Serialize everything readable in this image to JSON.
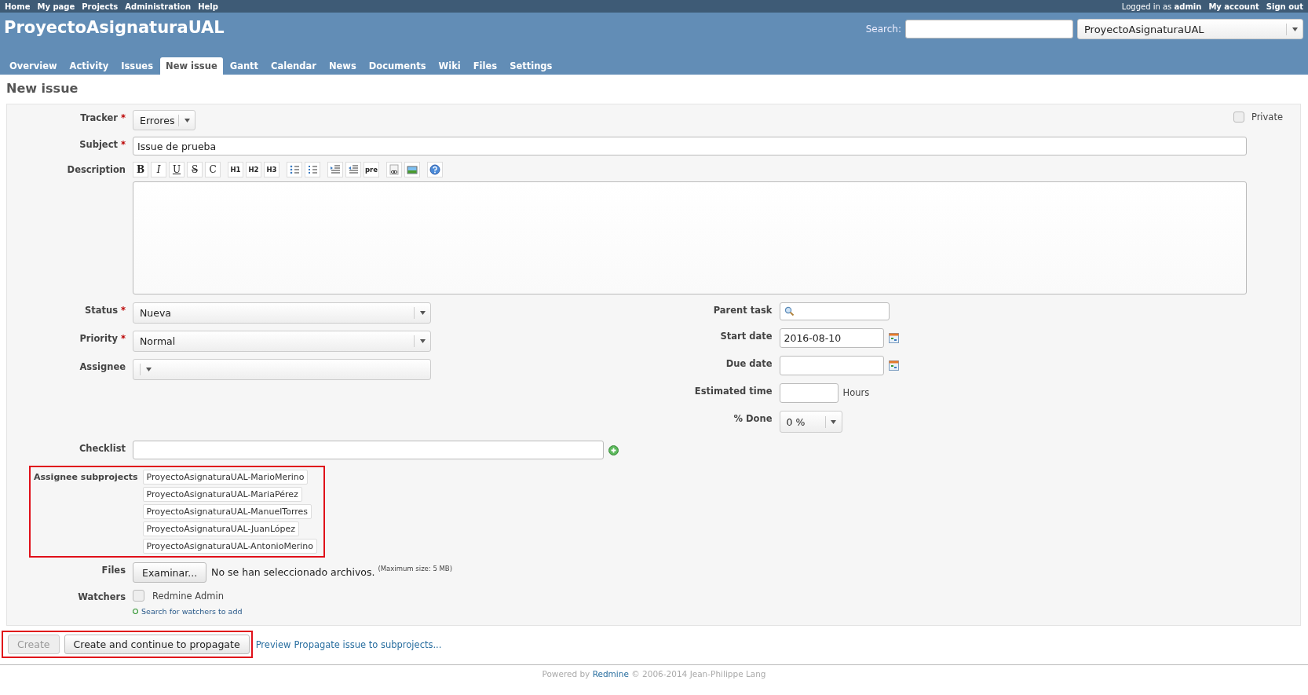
{
  "top_menu": {
    "left": [
      "Home",
      "My page",
      "Projects",
      "Administration",
      "Help"
    ],
    "logged_in_prefix": "Logged in as",
    "user": "admin",
    "right": [
      "My account",
      "Sign out"
    ]
  },
  "header": {
    "title": "ProyectoAsignaturaUAL",
    "search_label": "Search:",
    "project_select": "ProyectoAsignaturaUAL"
  },
  "tabs": [
    {
      "label": "Overview",
      "selected": false
    },
    {
      "label": "Activity",
      "selected": false
    },
    {
      "label": "Issues",
      "selected": false
    },
    {
      "label": "New issue",
      "selected": true
    },
    {
      "label": "Gantt",
      "selected": false
    },
    {
      "label": "Calendar",
      "selected": false
    },
    {
      "label": "News",
      "selected": false
    },
    {
      "label": "Documents",
      "selected": false
    },
    {
      "label": "Wiki",
      "selected": false
    },
    {
      "label": "Files",
      "selected": false
    },
    {
      "label": "Settings",
      "selected": false
    }
  ],
  "page_title": "New issue",
  "form": {
    "tracker": {
      "label": "Tracker",
      "required_mark": "*",
      "value": "Errores"
    },
    "private": {
      "label": "Private",
      "checked": false
    },
    "subject": {
      "label": "Subject",
      "required_mark": "*",
      "value": "Issue de prueba"
    },
    "description": {
      "label": "Description",
      "toolbar": [
        [
          {
            "kind": "bold",
            "text": "B"
          },
          {
            "kind": "italic",
            "text": "I"
          },
          {
            "kind": "underline",
            "text": "U"
          },
          {
            "kind": "strike",
            "text": "S"
          },
          {
            "kind": "plain",
            "text": "C"
          }
        ],
        [
          {
            "kind": "small",
            "text": "H1"
          },
          {
            "kind": "small",
            "text": "H2"
          },
          {
            "kind": "small",
            "text": "H3"
          }
        ],
        [
          {
            "kind": "bullets"
          },
          {
            "kind": "numbers"
          }
        ],
        [
          {
            "kind": "indent"
          },
          {
            "kind": "outdent"
          },
          {
            "kind": "small",
            "text": "pre"
          }
        ],
        [
          {
            "kind": "link"
          },
          {
            "kind": "image"
          }
        ],
        [
          {
            "kind": "help"
          }
        ]
      ]
    },
    "left_fields": [
      {
        "label": "Status",
        "required_mark": "*",
        "value": "Nueva"
      },
      {
        "label": "Priority",
        "required_mark": "*",
        "value": "Normal"
      },
      {
        "label": "Assignee"
      }
    ],
    "right_fields": [
      {
        "kind": "search",
        "label": "Parent task"
      },
      {
        "kind": "date",
        "label": "Start date",
        "value": "2016-08-10"
      },
      {
        "kind": "date",
        "label": "Due date"
      },
      {
        "kind": "hours",
        "label": "Estimated time",
        "unit": "Hours"
      },
      {
        "kind": "select",
        "label": "% Done",
        "value": "0 %"
      }
    ],
    "checklist": {
      "label": "Checklist"
    },
    "assignee_subprojects": {
      "label": "Assignee subprojects",
      "highlighted": true,
      "items": [
        "ProyectoAsignaturaUAL-MarioMerino",
        "ProyectoAsignaturaUAL-MariaPérez",
        "ProyectoAsignaturaUAL-ManuelTorres",
        "ProyectoAsignaturaUAL-JuanLópez",
        "ProyectoAsignaturaUAL-AntonioMerino"
      ]
    },
    "files": {
      "label": "Files",
      "button": "Examinar...",
      "status": "No se han seleccionado archivos.",
      "max_size": "(Maximum size: 5 MB)"
    },
    "watchers": {
      "label": "Watchers",
      "items": [
        {
          "label": "Redmine Admin",
          "checked": false
        }
      ],
      "search_link": "Search for watchers to add"
    }
  },
  "actions": {
    "highlighted": true,
    "create": {
      "label": "Create",
      "disabled": true
    },
    "create_continue": "Create and continue to propagate",
    "preview_link": "Preview",
    "propagate_link": "Propagate issue to subprojects..."
  },
  "footer": {
    "prefix": "Powered by",
    "link": "Redmine",
    "suffix": "© 2006-2014 Jean-Philippe Lang"
  }
}
